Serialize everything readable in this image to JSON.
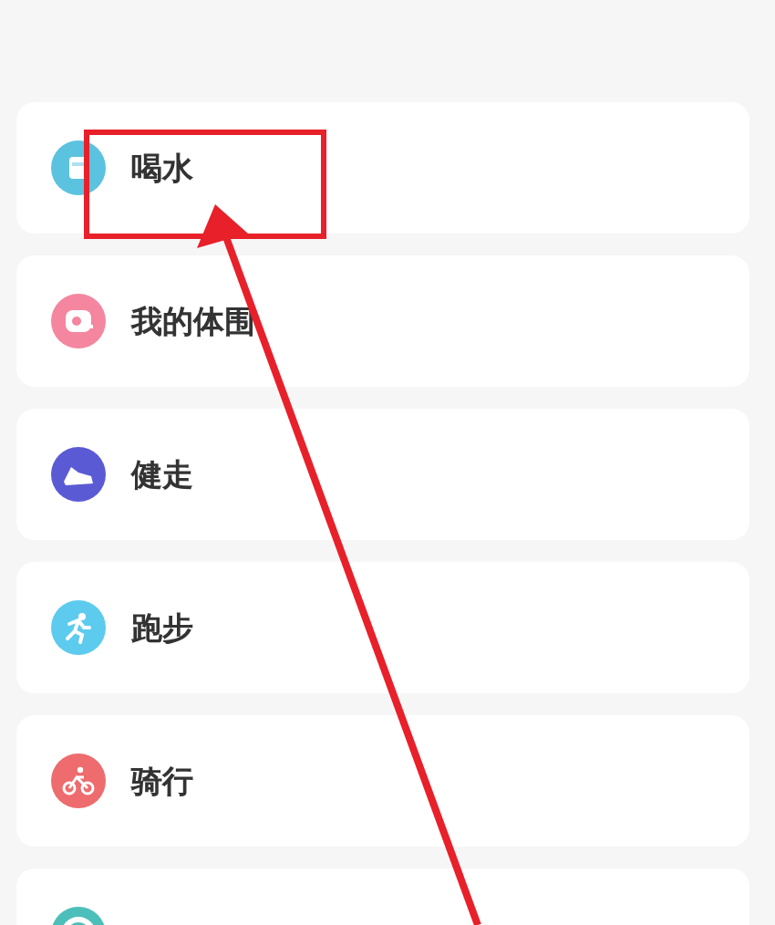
{
  "tools": [
    {
      "label": "喝水",
      "kind": "cup",
      "color": "#5bc3e0"
    },
    {
      "label": "我的体围",
      "kind": "tape",
      "color": "#f4869f"
    },
    {
      "label": "健走",
      "kind": "shoe",
      "color": "#5a5bd4"
    },
    {
      "label": "跑步",
      "kind": "runner",
      "color": "#5ccbee"
    },
    {
      "label": "骑行",
      "kind": "bike",
      "color": "#ee6b6e"
    },
    {
      "kind": "ring",
      "color": "#4cbfba"
    }
  ],
  "annotation": {
    "highlight_frame": true,
    "arrow": true
  }
}
